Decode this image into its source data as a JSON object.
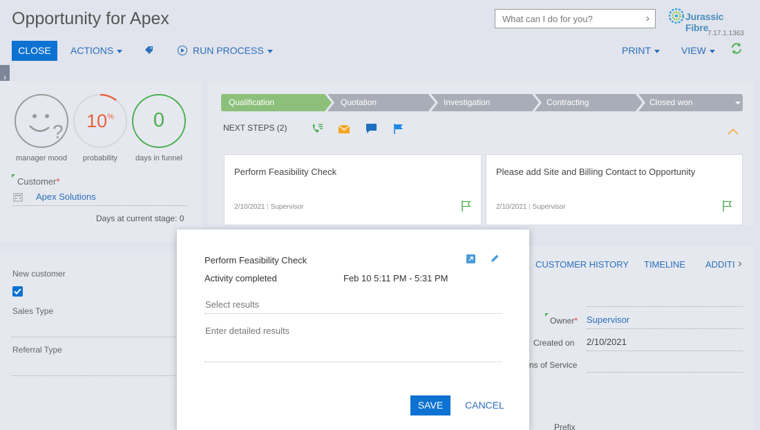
{
  "header": {
    "title": "Opportunity for Apex",
    "search_placeholder": "What can I do for you?",
    "brand": "Jurassic Fibre",
    "version": "7.17.1.1363"
  },
  "toolbar": {
    "close": "CLOSE",
    "actions": "ACTIONS",
    "run_process": "RUN PROCESS",
    "print": "PRINT",
    "view": "VIEW"
  },
  "profile": {
    "mood_label": "manager mood",
    "probability_value": "10",
    "probability_unit": "%",
    "probability_label": "probability",
    "days_value": "0",
    "days_label": "days in funnel",
    "customer_label": "Customer",
    "customer_value": "Apex Solutions",
    "days_stage_label": "Days at current stage:",
    "days_stage_value": "0"
  },
  "stages": [
    "Qualification",
    "Quotation",
    "Investigation",
    "Contracting",
    "Closed won"
  ],
  "next_steps": {
    "label": "NEXT STEPS (2)",
    "cards": [
      {
        "title": "Perform Feasibility Check",
        "date": "2/10/2021",
        "owner": "Supervisor"
      },
      {
        "title": "Please add Site and Billing Contact to Opportunity",
        "date": "2/10/2021",
        "owner": "Supervisor"
      }
    ]
  },
  "left_fields": {
    "new_customer": "New customer",
    "sales_type": "Sales Type",
    "referral_type": "Referral Type"
  },
  "tabs": {
    "customer_history": "CUSTOMER HISTORY",
    "timeline": "TIMELINE",
    "additional": "ADDITI"
  },
  "right_fields": {
    "owner_label": "Owner",
    "owner_value": "Supervisor",
    "created_label": "Created on",
    "created_value": "2/10/2021",
    "terms_label": "ns of Service",
    "prefix_label": "Prefix"
  },
  "modal": {
    "title": "Perform Feasibility Check",
    "status": "Activity completed",
    "time": "Feb 10 5:11 PM - 5:31 PM",
    "results_placeholder": "Select results",
    "details_placeholder": "Enter detailed results",
    "save": "SAVE",
    "cancel": "CANCEL"
  },
  "colors": {
    "accent": "#0d72d1",
    "stage_active": "#8cc07a",
    "stage_inactive": "#a9adb7",
    "green": "#4caf50",
    "orange": "#e8613a"
  }
}
